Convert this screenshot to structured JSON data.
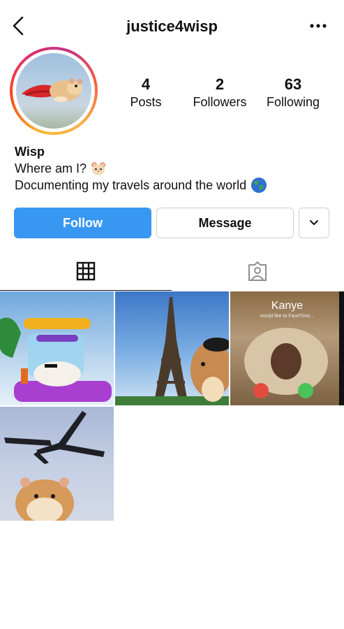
{
  "header": {
    "username": "justice4wisp",
    "back_icon": "chevron-left-icon",
    "more_icon": "more-horizontal-icon"
  },
  "profile": {
    "stats": [
      {
        "value": "4",
        "label": "Posts"
      },
      {
        "value": "2",
        "label": "Followers"
      },
      {
        "value": "63",
        "label": "Following"
      }
    ],
    "name": "Wisp",
    "bio_line1": "Where am I?",
    "bio_line2": "Documenting my travels around the world",
    "bio_emoji1": "hamster-face-emoji",
    "bio_emoji2": "globe-emoji"
  },
  "actions": {
    "follow_label": "Follow",
    "message_label": "Message",
    "dropdown_icon": "chevron-down-icon"
  },
  "tabs": {
    "grid_icon": "grid-icon",
    "tagged_icon": "tagged-person-icon"
  },
  "posts": [
    {
      "subject": "hamster in floating playhouse"
    },
    {
      "subject": "hamster at Eiffel Tower"
    },
    {
      "subject": "hamster FaceTime call",
      "caller_name": "Kanye",
      "caller_sub": "would like to FaceTime..."
    },
    {
      "subject": "hamster with airplane"
    }
  ],
  "colors": {
    "follow_button": "#3897f0",
    "ring_gradient": [
      "#f7b733",
      "#fc4a1a",
      "#e1306c",
      "#c13584"
    ]
  }
}
